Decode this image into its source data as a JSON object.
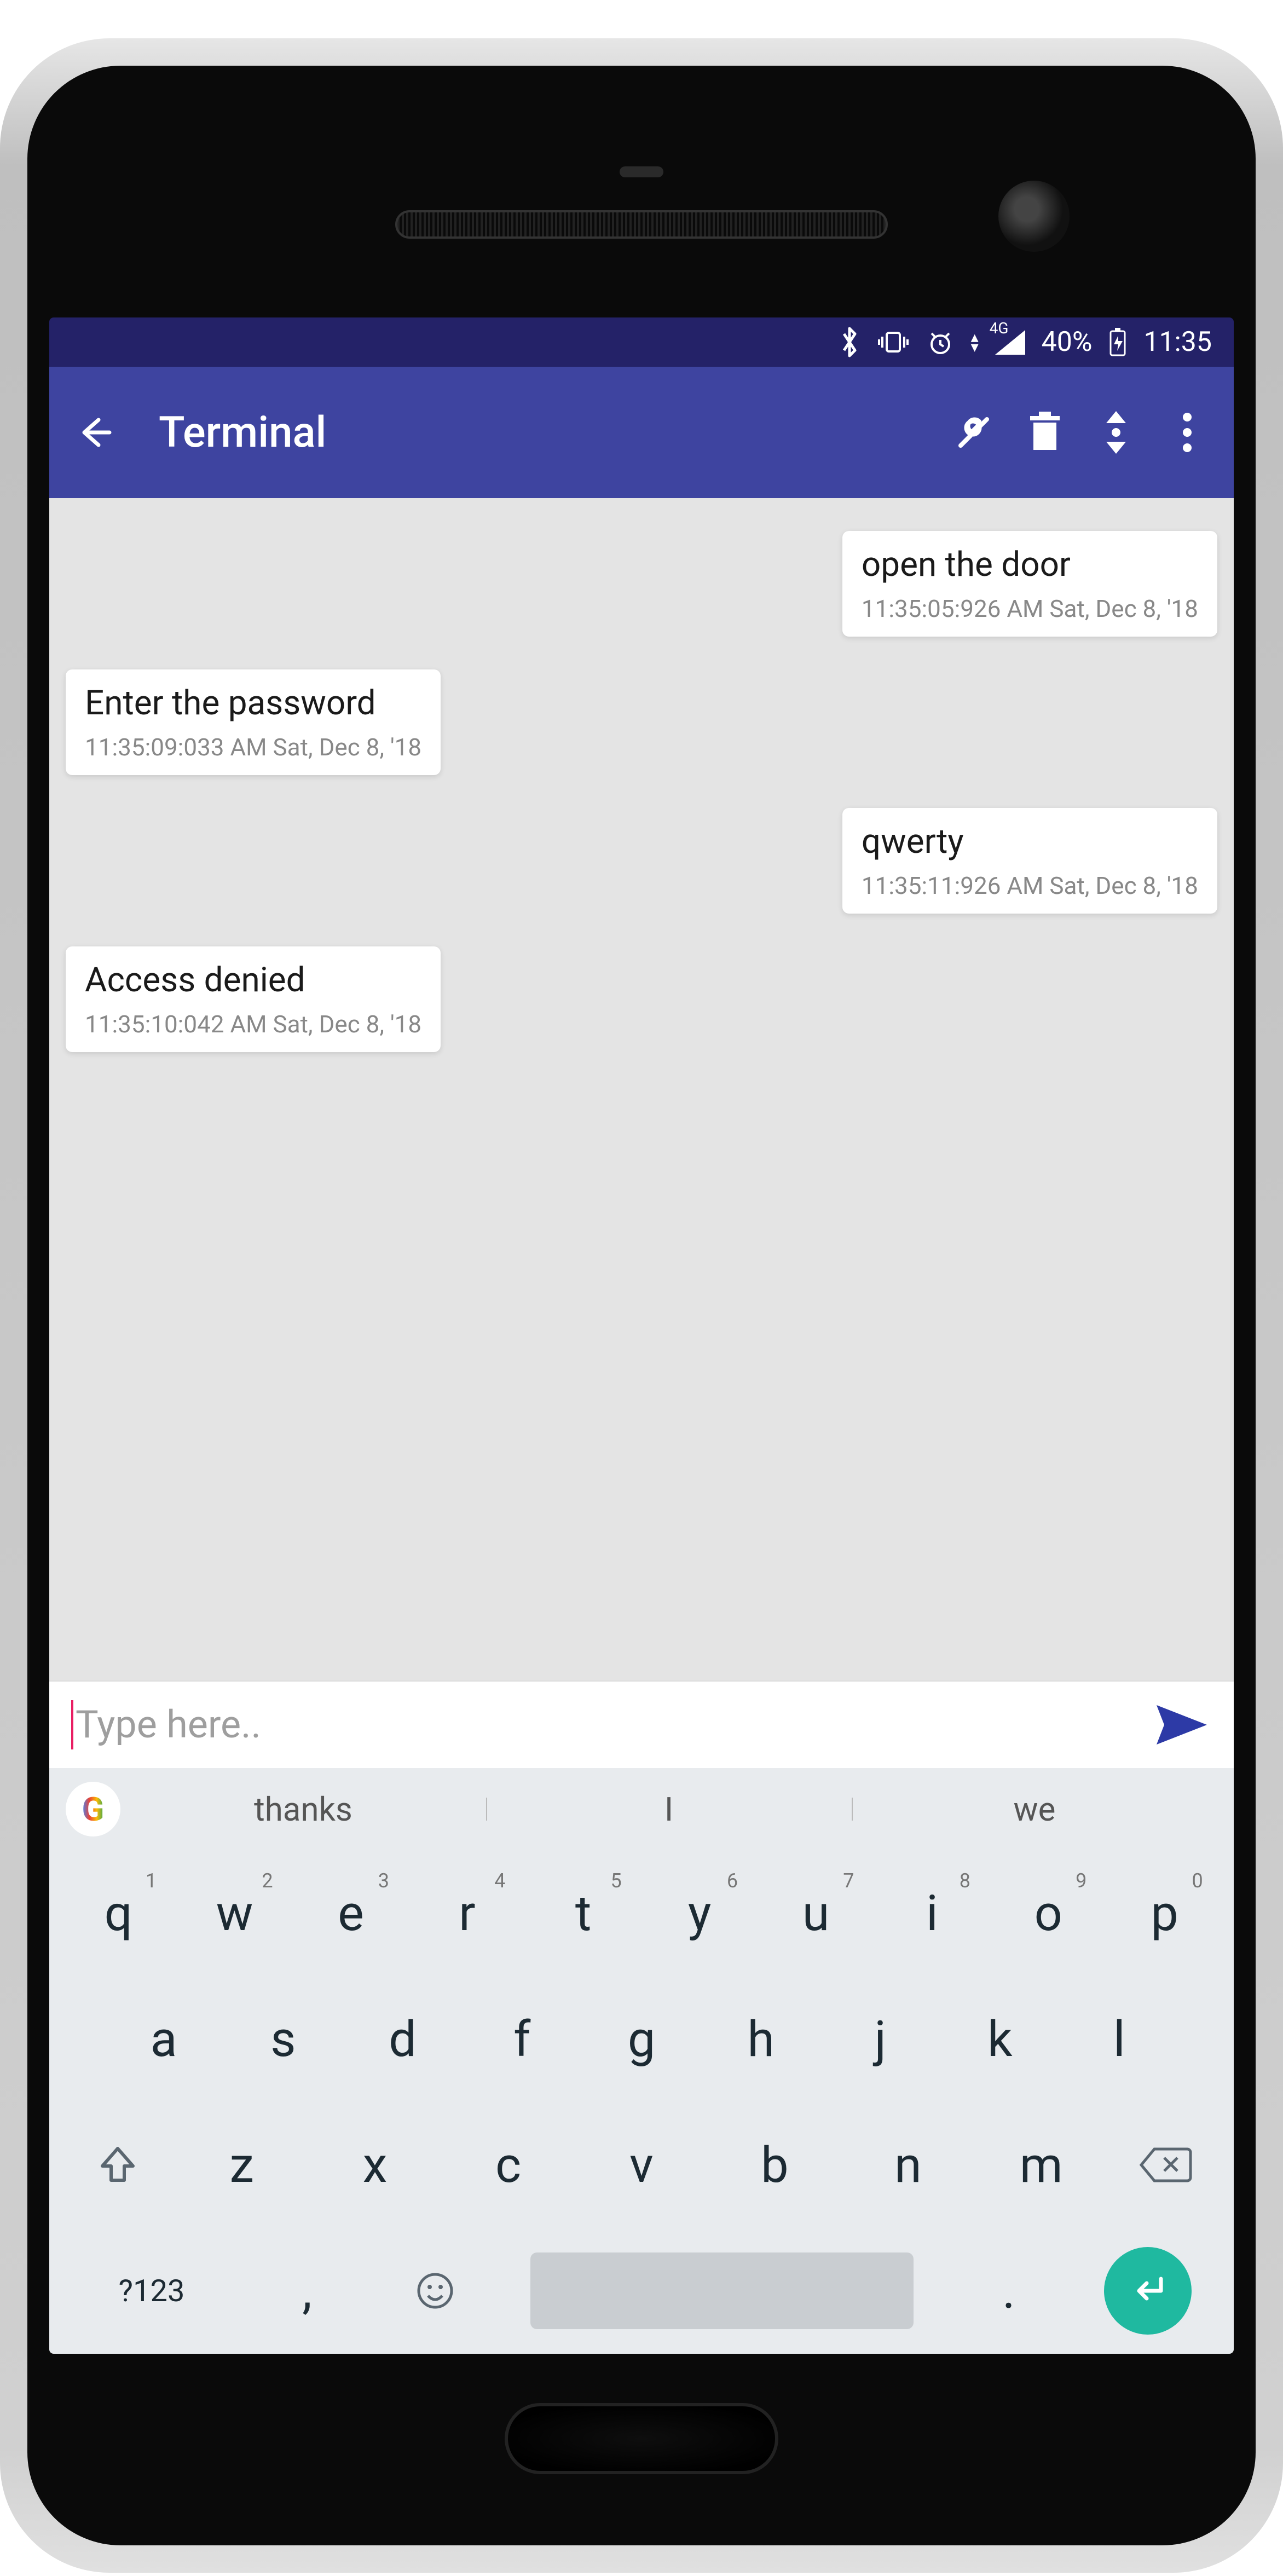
{
  "status": {
    "battery": "40%",
    "time": "11:35",
    "network_badge": "4G"
  },
  "appbar": {
    "title": "Terminal"
  },
  "messages": [
    {
      "side": "right",
      "text": "open the door",
      "timestamp": "11:35:05:926 AM Sat, Dec 8, '18"
    },
    {
      "side": "left",
      "text": "Enter the password",
      "timestamp": "11:35:09:033 AM Sat, Dec 8, '18"
    },
    {
      "side": "right",
      "text": "qwerty",
      "timestamp": "11:35:11:926 AM Sat, Dec 8, '18"
    },
    {
      "side": "left",
      "text": "Access denied",
      "timestamp": "11:35:10:042 AM Sat, Dec 8, '18"
    }
  ],
  "input": {
    "placeholder": "Type here.."
  },
  "suggestions": [
    "thanks",
    "I",
    "we"
  ],
  "keyboard": {
    "r1": [
      "q",
      "w",
      "e",
      "r",
      "t",
      "y",
      "u",
      "i",
      "o",
      "p"
    ],
    "r1sup": [
      "1",
      "2",
      "3",
      "4",
      "5",
      "6",
      "7",
      "8",
      "9",
      "0"
    ],
    "r2": [
      "a",
      "s",
      "d",
      "f",
      "g",
      "h",
      "j",
      "k",
      "l"
    ],
    "r3": [
      "z",
      "x",
      "c",
      "v",
      "b",
      "n",
      "m"
    ],
    "sym": "?123",
    "comma": ",",
    "dot": "."
  }
}
